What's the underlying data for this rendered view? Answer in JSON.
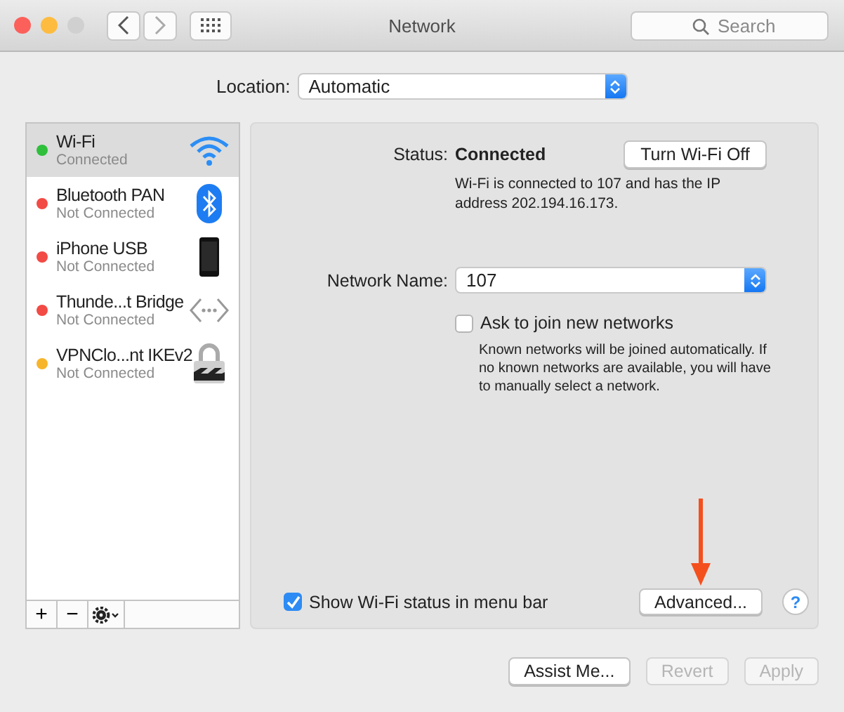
{
  "window": {
    "title": "Network",
    "search_placeholder": "Search"
  },
  "location": {
    "label": "Location:",
    "value": "Automatic"
  },
  "services": [
    {
      "name": "Wi-Fi",
      "status": "Connected",
      "color": "#2fbf3b",
      "kind": "wifi",
      "selected": true
    },
    {
      "name": "Bluetooth PAN",
      "status": "Not Connected",
      "color": "#f24a45",
      "kind": "bluetooth",
      "selected": false
    },
    {
      "name": "iPhone USB",
      "status": "Not Connected",
      "color": "#f24a45",
      "kind": "phone",
      "selected": false
    },
    {
      "name": "Thunde...t Bridge",
      "status": "Not Connected",
      "color": "#f24a45",
      "kind": "bridge",
      "selected": false
    },
    {
      "name": "VPNClo...nt IKEv2",
      "status": "Not Connected",
      "color": "#f6b52b",
      "kind": "vpn",
      "selected": false
    }
  ],
  "sidebar_toolbar": [
    "+",
    "−"
  ],
  "detail": {
    "status_label": "Status:",
    "status_value": "Connected",
    "toggle_button": "Turn Wi-Fi Off",
    "status_description": "Wi-Fi is connected to 107 and has the IP address 202.194.16.173.",
    "network_label": "Network Name:",
    "network_value": "107",
    "ask_join": {
      "label": "Ask to join new networks",
      "checked": false
    },
    "ask_join_help": "Known networks will be joined automatically. If no known networks are available, you will have to manually select a network.",
    "show_status": {
      "label": "Show Wi-Fi status in menu bar",
      "checked": true
    },
    "advanced_button": "Advanced...",
    "help_button": "?"
  },
  "footer_buttons": [
    {
      "label": "Assist Me...",
      "disabled": false
    },
    {
      "label": "Revert",
      "disabled": true
    },
    {
      "label": "Apply",
      "disabled": true
    }
  ]
}
